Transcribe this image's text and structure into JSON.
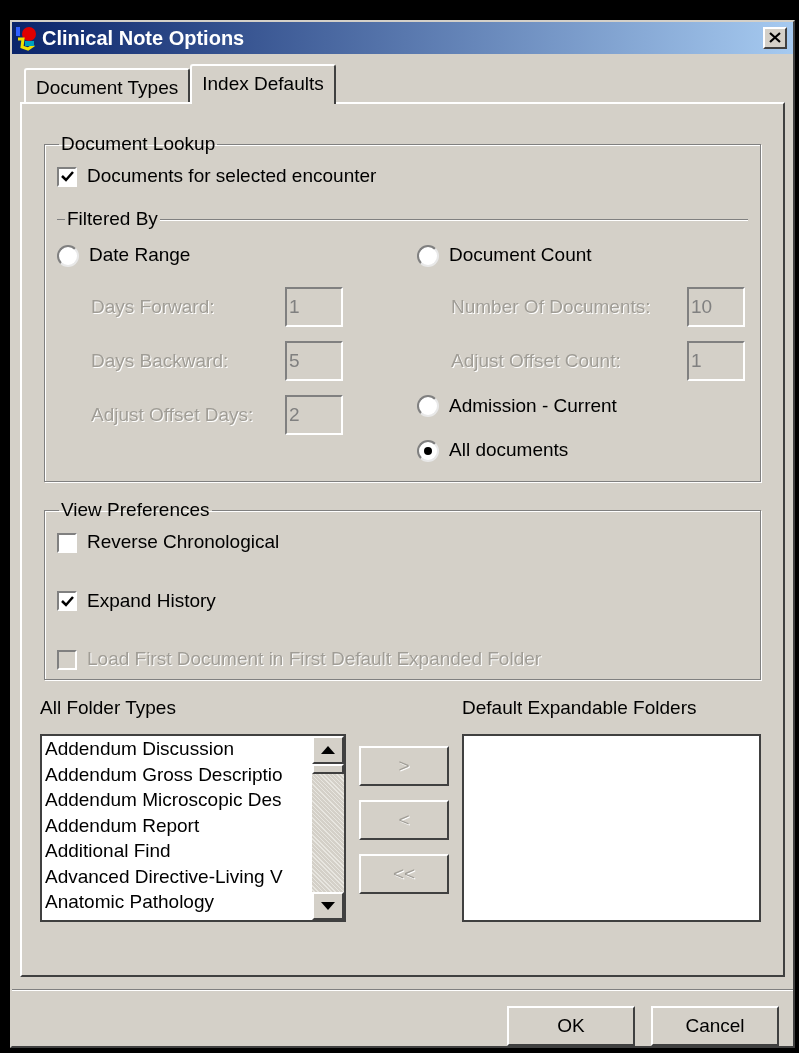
{
  "window": {
    "title": "Clinical Note Options"
  },
  "tabs": [
    {
      "label": "Document Types",
      "selected": false
    },
    {
      "label": "Index Defaults",
      "selected": true
    }
  ],
  "document_lookup": {
    "title": "Document Lookup",
    "encounter": {
      "label": "Documents for selected encounter",
      "checked": true
    },
    "filtered_by": "Filtered By",
    "left": {
      "radio": {
        "label": "Date Range",
        "selected": false
      },
      "fields": [
        {
          "label": "Days Forward:",
          "value": "1",
          "disabled": true
        },
        {
          "label": "Days Backward:",
          "value": "5",
          "disabled": true
        },
        {
          "label": "Adjust Offset Days:",
          "value": "2",
          "disabled": true
        }
      ]
    },
    "right": {
      "radio": {
        "label": "Document Count",
        "selected": false
      },
      "fields": [
        {
          "label": "Number Of Documents:",
          "value": "10",
          "disabled": true
        },
        {
          "label": "Adjust Offset Count:",
          "value": "1",
          "disabled": true
        }
      ],
      "radios": [
        {
          "label": "Admission - Current",
          "selected": false
        },
        {
          "label": "All documents",
          "selected": true
        }
      ]
    }
  },
  "view_preferences": {
    "title": "View Preferences",
    "options": [
      {
        "label": "Reverse Chronological",
        "checked": false,
        "disabled": false
      },
      {
        "label": "Expand History",
        "checked": true,
        "disabled": false
      },
      {
        "label": "Load First Document in First Default Expanded Folder",
        "checked": false,
        "disabled": true
      }
    ]
  },
  "folders": {
    "all_label": "All Folder Types",
    "items": [
      "Addendum Discussion",
      "Addendum Gross Descriptio",
      "Addendum Microscopic Des",
      "Addendum Report",
      "Additional Find",
      "Advanced Directive-Living V",
      "Anatomic Pathology"
    ],
    "move_buttons": [
      {
        "label": ">",
        "disabled": true
      },
      {
        "label": "<",
        "disabled": true
      },
      {
        "label": "<<",
        "disabled": true
      }
    ],
    "default_label": "Default Expandable Folders"
  },
  "buttons": [
    {
      "label": "OK"
    },
    {
      "label": "Cancel"
    }
  ]
}
